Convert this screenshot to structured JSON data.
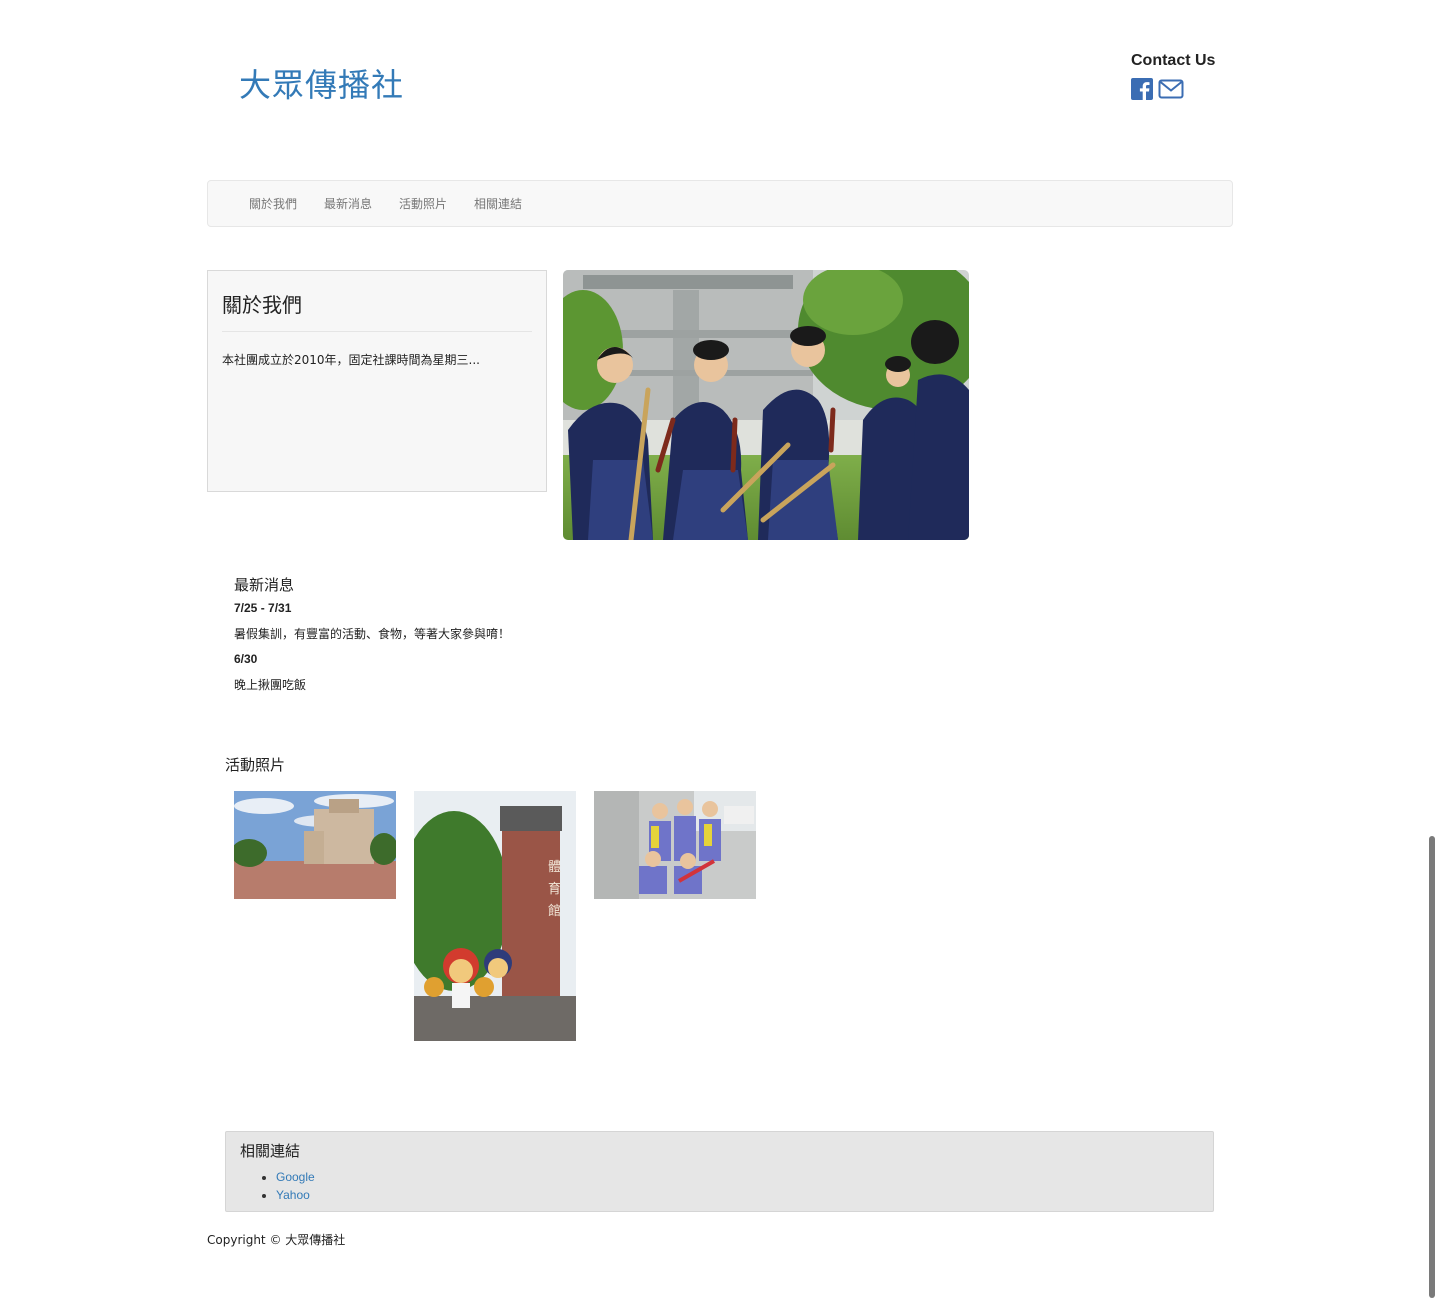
{
  "header": {
    "brand": "大眾傳播社",
    "contact_title": "Contact Us",
    "icons": [
      "facebook-icon",
      "mail-icon"
    ]
  },
  "nav": {
    "items": [
      {
        "label": "關於我們"
      },
      {
        "label": "最新消息"
      },
      {
        "label": "活動照片"
      },
      {
        "label": "相關連結"
      }
    ]
  },
  "about": {
    "title": "關於我們",
    "text": "本社團成立於2010年，固定社課時間為星期三..."
  },
  "news": {
    "title": "最新消息",
    "entries": [
      {
        "date": "7/25 - 7/31",
        "text": "暑假集訓，有豐富的活動、食物，等著大家參與唷！"
      },
      {
        "date": "6/30",
        "text": "晚上揪團吃飯"
      }
    ]
  },
  "photos": {
    "title": "活動照片"
  },
  "links": {
    "title": "相關連結",
    "items": [
      {
        "label": "Google"
      },
      {
        "label": "Yahoo"
      }
    ]
  },
  "footer": {
    "copyright": "Copyright © 大眾傳播社"
  },
  "colors": {
    "brand": "#337ab7",
    "navbar_bg": "#f8f8f8",
    "links_bg": "#e6e6e6"
  }
}
